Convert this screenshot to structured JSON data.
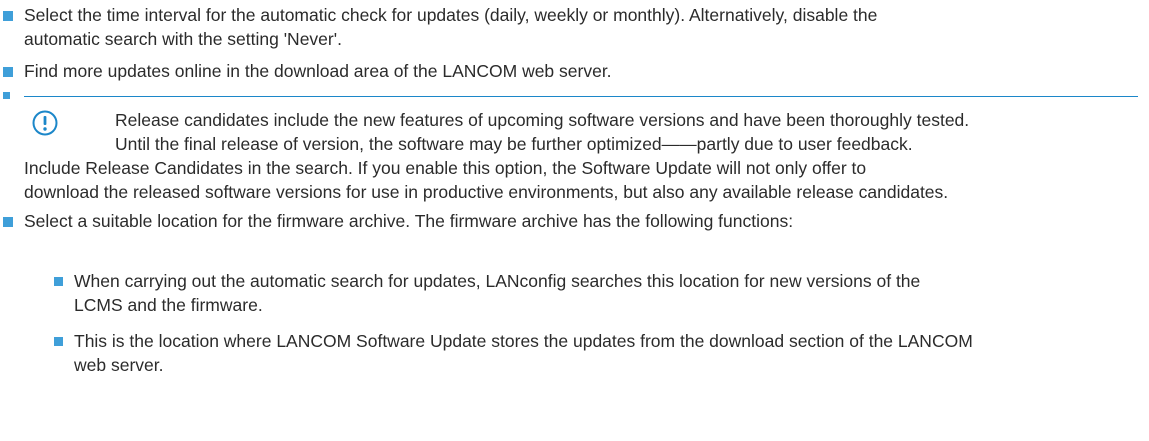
{
  "bullets": [
    {
      "lines": [
        "Select the time interval for the automatic check for updates (daily, weekly or monthly). Alternatively, disable the",
        "automatic search with the setting 'Never'."
      ]
    },
    {
      "lines": [
        "Find more updates online in the download area of the LANCOM web server."
      ]
    }
  ],
  "note": {
    "icon": "exclamation-circle-icon",
    "lines": [
      "Release candidates include the new features of upcoming software versions and have been thoroughly tested.",
      "Until the final release of version, the software may be further optimized——partly due to user feedback."
    ]
  },
  "release_candidates_text": [
    "Include Release Candidates in the search. If you enable this option, the Software Update will not only offer to",
    "download the released software versions for use in productive environments, but also any available release candidates."
  ],
  "archive": {
    "intro": "Select a suitable location for the firmware archive. The firmware archive has the following functions:",
    "sub_bullets": [
      {
        "lines": [
          "When carrying out the automatic search for updates, LANconfig searches this location for new versions of the",
          "LCMS and the firmware."
        ]
      },
      {
        "lines": [
          "This is the location where LANCOM Software Update stores the updates from the download section of the LANCOM",
          "web server."
        ]
      }
    ]
  },
  "colors": {
    "bullet": "#3f9fd9",
    "rule": "#1c87c9",
    "icon": "#1c87c9",
    "text": "#2b2b2b"
  }
}
